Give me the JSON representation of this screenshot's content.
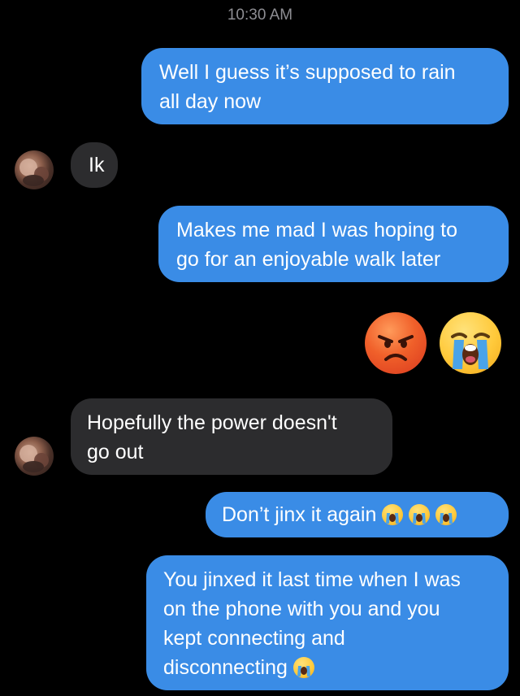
{
  "header": {
    "timestamp": "10:30 AM"
  },
  "messages": [
    {
      "from": "me",
      "lines": [
        "Well I guess it’s supposed to rain",
        "all day now"
      ]
    },
    {
      "from": "them",
      "lines": [
        "Ik"
      ]
    },
    {
      "from": "me",
      "lines": [
        "Makes me mad I was hoping to",
        "go for an enjoyable walk later"
      ]
    },
    {
      "from": "me",
      "type": "emoji",
      "emojis": [
        "angry-face-emoji",
        "loudly-crying-face-emoji"
      ]
    },
    {
      "from": "them",
      "lines": [
        "Hopefully the power doesn't",
        "go out"
      ]
    },
    {
      "from": "me",
      "lines": [
        "Don’t jinx it again"
      ],
      "trailing_emojis": [
        "loudly-crying-face-emoji",
        "loudly-crying-face-emoji",
        "loudly-crying-face-emoji"
      ]
    },
    {
      "from": "me",
      "lines": [
        "You jinxed it last time when I was",
        "on the phone with you and you",
        "kept connecting and",
        "disconnecting"
      ],
      "trailing_emojis": [
        "loudly-crying-face-emoji"
      ]
    }
  ],
  "colors": {
    "outgoing_bubble": "#3a8ce6",
    "incoming_bubble": "#2c2c2e",
    "background": "#000000",
    "timestamp_text": "#8e8e93"
  }
}
